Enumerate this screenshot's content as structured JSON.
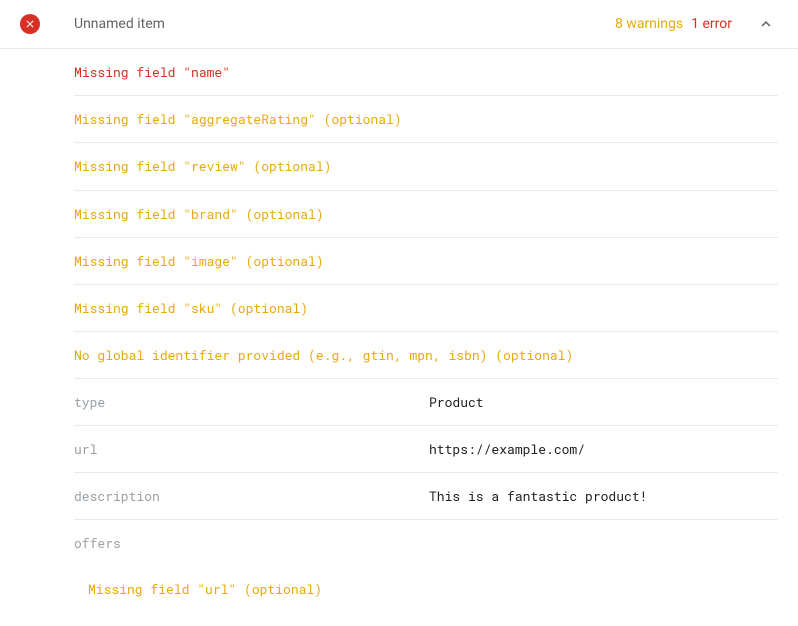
{
  "header": {
    "title": "Unnamed item",
    "warnings_label": "8 warnings",
    "errors_label": "1 error"
  },
  "messages": [
    {
      "severity": "error",
      "text": "Missing field \"name\""
    },
    {
      "severity": "warning",
      "text": "Missing field \"aggregateRating\" (optional)"
    },
    {
      "severity": "warning",
      "text": "Missing field \"review\" (optional)"
    },
    {
      "severity": "warning",
      "text": "Missing field \"brand\" (optional)"
    },
    {
      "severity": "warning",
      "text": "Missing field \"image\" (optional)"
    },
    {
      "severity": "warning",
      "text": "Missing field \"sku\" (optional)"
    },
    {
      "severity": "warning",
      "text": "No global identifier provided (e.g., gtin, mpn, isbn) (optional)"
    }
  ],
  "properties": [
    {
      "key": "type",
      "value": "Product"
    },
    {
      "key": "url",
      "value": "https://example.com/"
    },
    {
      "key": "description",
      "value": "This is a fantastic product!"
    },
    {
      "key": "offers",
      "value": ""
    }
  ],
  "offers_messages": [
    {
      "severity": "warning",
      "text": "Missing field \"url\" (optional)"
    }
  ]
}
